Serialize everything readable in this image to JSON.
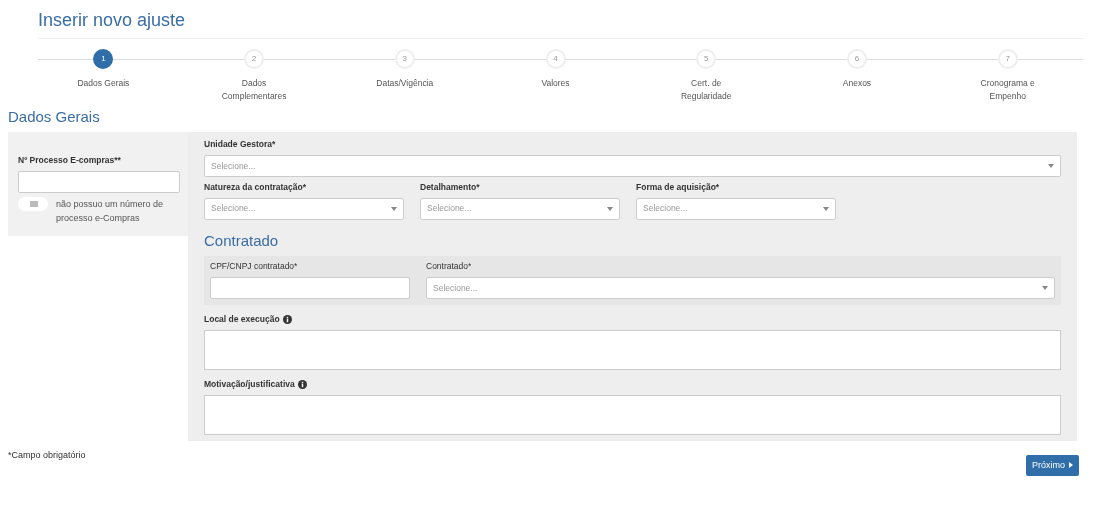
{
  "title": "Inserir novo ajuste",
  "steps": [
    {
      "number": "1",
      "label": "Dados Gerais",
      "selected": true
    },
    {
      "number": "2",
      "label": "Dados Complementares",
      "selected": false
    },
    {
      "number": "3",
      "label": "Datas/Vigência",
      "selected": false
    },
    {
      "number": "4",
      "label": "Valores",
      "selected": false
    },
    {
      "number": "5",
      "label": "Cert. de Regularidade",
      "selected": false
    },
    {
      "number": "6",
      "label": "Anexos",
      "selected": false
    },
    {
      "number": "7",
      "label": "Cronograma e Empenho",
      "selected": false
    }
  ],
  "section_title": "Dados Gerais",
  "process": {
    "label": "Nº Processo E-compras**",
    "toggle_on": false,
    "toggle_label": "não possuo um número de processo e-Compras"
  },
  "unidade": {
    "label": "Unidade Gestora*",
    "placeholder": "Selecione..."
  },
  "selects": [
    {
      "label": "Natureza da contratação*",
      "placeholder": "Selecione..."
    },
    {
      "label": "Detalhamento*",
      "placeholder": "Selecione..."
    },
    {
      "label": "Forma de aquisição*",
      "placeholder": "Selecione..."
    }
  ],
  "contratado": {
    "title": "Contratado",
    "cpf_label": "CPF/CNPJ contratado*",
    "select_label": "Contratado*",
    "select_placeholder": "Selecione..."
  },
  "textareas": [
    {
      "label": "Local de execução"
    },
    {
      "label": "Motivação/justificativa"
    }
  ],
  "footnote": "*Campo obrigatório",
  "next_button": "Próximo"
}
